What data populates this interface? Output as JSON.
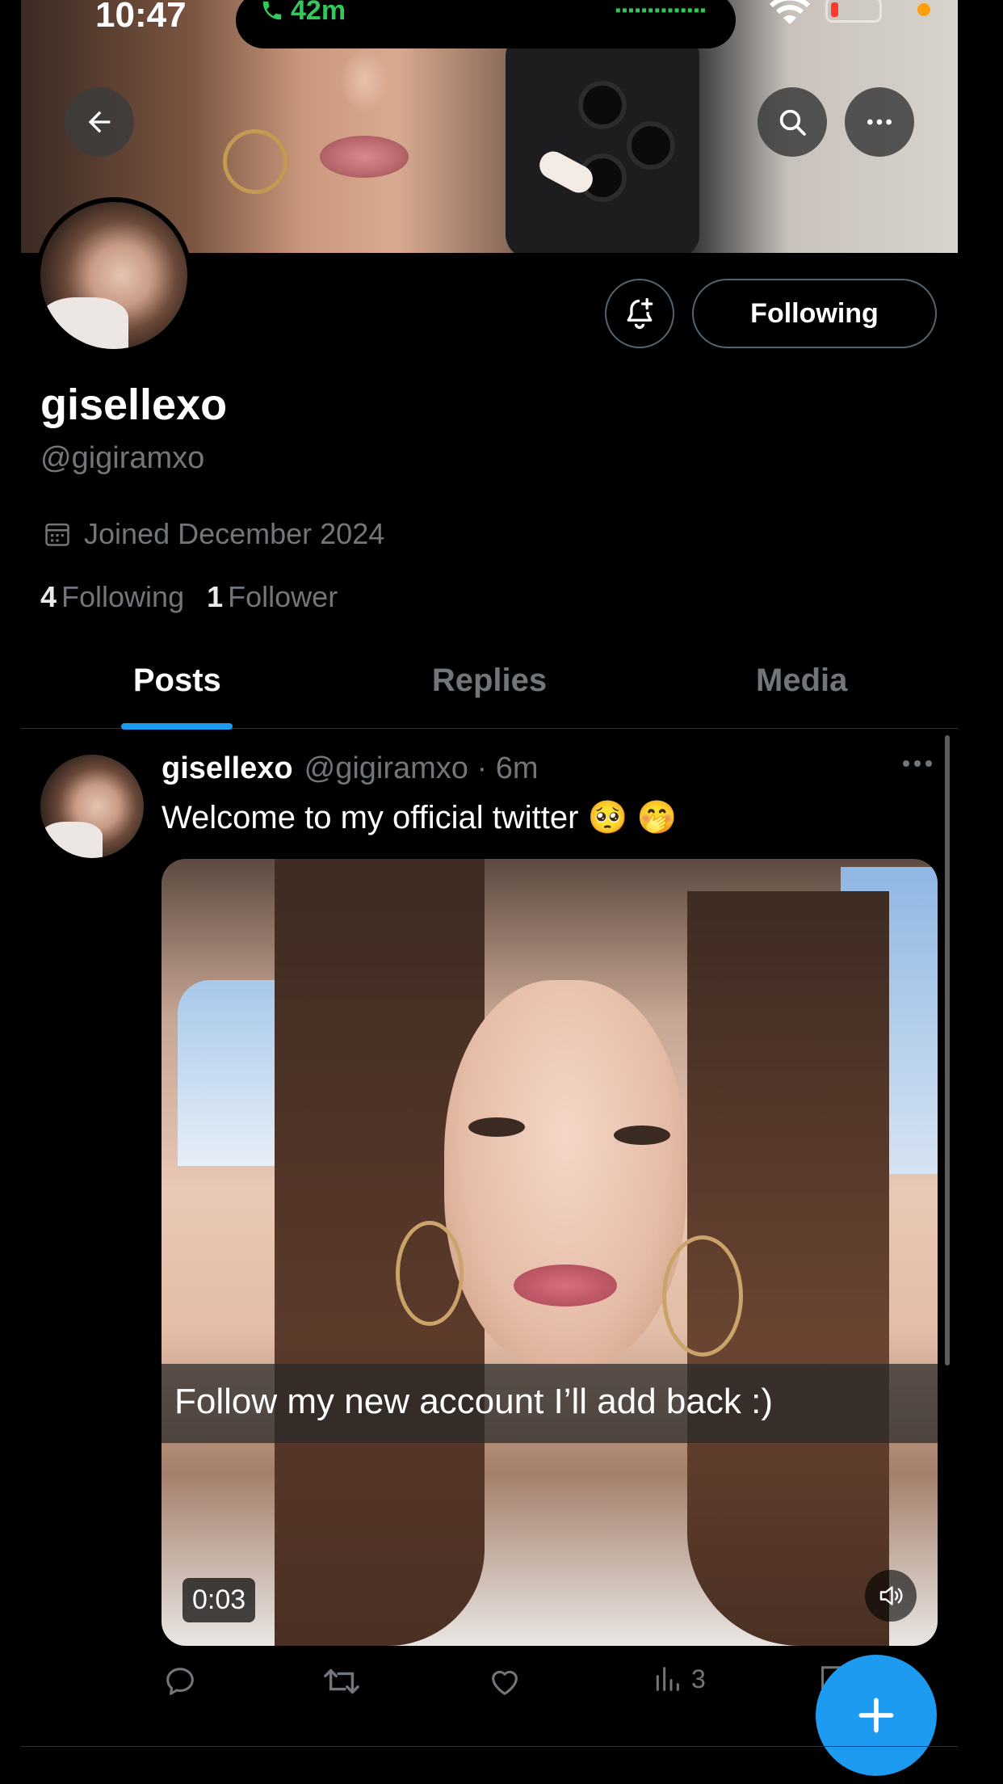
{
  "status_bar": {
    "time": "10:47",
    "call_duration": "42m"
  },
  "profile": {
    "display_name": "gisellexo",
    "handle": "@gigiramxo",
    "joined": "Joined December 2024",
    "following_count": "4",
    "following_label": "Following",
    "followers_count": "1",
    "followers_label": "Follower",
    "follow_button": "Following"
  },
  "tabs": [
    {
      "label": "Posts",
      "active": true
    },
    {
      "label": "Replies",
      "active": false
    },
    {
      "label": "Media",
      "active": false
    }
  ],
  "post": {
    "name": "gisellexo",
    "handle": "@gigiramxo",
    "separator": "·",
    "time": "6m",
    "text": "Welcome to my official twitter 🥺 🤭",
    "video_caption": "Follow my new account I’ll add back :)",
    "video_duration": "0:03",
    "views": "3"
  },
  "colors": {
    "accent": "#1d9bf0",
    "background": "#000000",
    "secondary_text": "#71767b",
    "call_green": "#34c759"
  },
  "icons": {
    "back": "back-arrow-icon",
    "search": "search-icon",
    "more": "more-icon",
    "notify": "bell-plus-icon",
    "calendar": "calendar-icon",
    "reply": "reply-icon",
    "retweet": "retweet-icon",
    "like": "heart-icon",
    "views": "views-icon",
    "compose": "plus-icon"
  }
}
